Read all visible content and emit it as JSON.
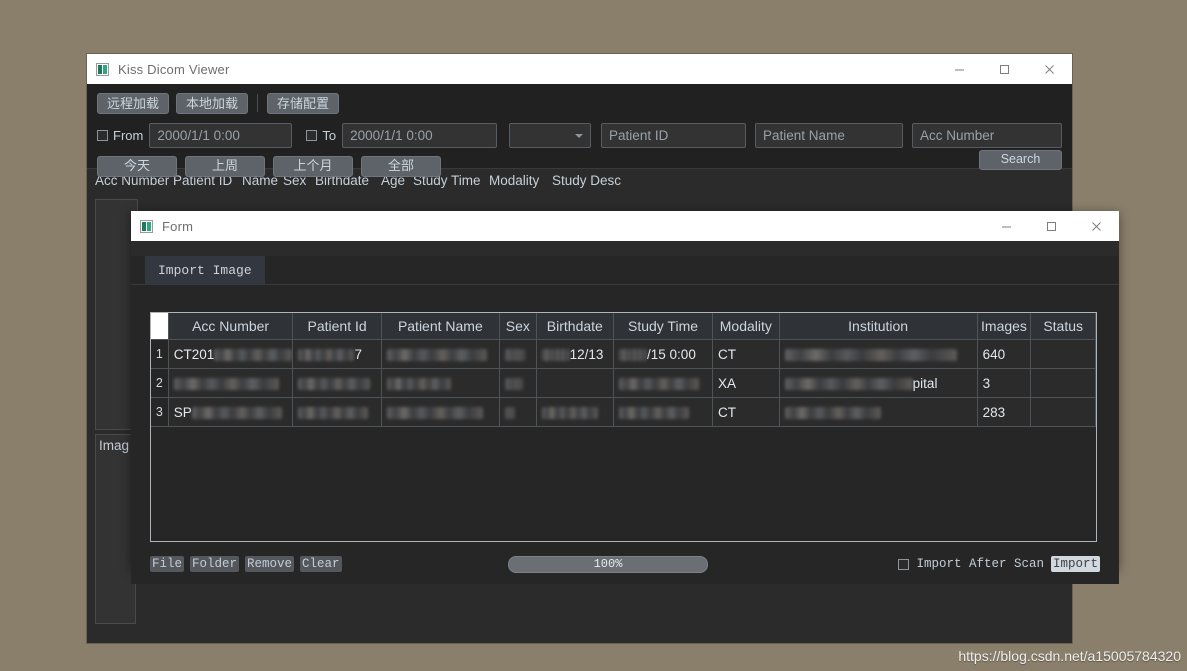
{
  "main_window": {
    "title": "Kiss Dicom Viewer",
    "icon": "app-icon",
    "window_controls": {
      "minimize": "—",
      "maximize": "□",
      "close": "✕"
    },
    "toolbar": {
      "buttons": [
        "远程加载",
        "本地加载",
        "存储配置"
      ],
      "from_label": "From",
      "from_value": "2000/1/1 0:00",
      "to_label": "To",
      "to_value": "2000/1/1 0:00",
      "modality_select": "",
      "patient_id_placeholder": "Patient ID",
      "patient_name_placeholder": "Patient Name",
      "acc_number_placeholder": "Acc Number",
      "quick_buttons": [
        "今天",
        "上周",
        "上个月",
        "全部"
      ],
      "search_label": "Search"
    },
    "grid_headers": [
      "Acc Number",
      "Patient ID",
      "Name",
      "Sex",
      "Birthdate",
      "Age",
      "Study Time",
      "Modality",
      "Study Desc"
    ],
    "image_panel_label": "Imag"
  },
  "form_window": {
    "title": "Form",
    "icon": "app-icon",
    "window_controls": {
      "minimize": "—",
      "maximize": "□",
      "close": "✕"
    },
    "tabs": [
      {
        "label": "Import Image",
        "active": true
      }
    ],
    "table": {
      "headers": [
        "",
        "Acc Number",
        "Patient Id",
        "Patient Name",
        "Sex",
        "Birthdate",
        "Study Time",
        "Modality",
        "Institution",
        "Images",
        "Status"
      ],
      "rows": [
        {
          "index": "1",
          "acc_number": "CT201",
          "acc_number_redacted": true,
          "patient_id": "7",
          "patient_id_redacted": true,
          "patient_name": "",
          "patient_name_redacted": true,
          "sex": "",
          "sex_redacted": true,
          "birthdate": "12/13",
          "birthdate_redacted": true,
          "study_time": "/15 0:00",
          "study_time_redacted": true,
          "modality": "CT",
          "institution": "",
          "institution_redacted": true,
          "images": "640",
          "status": ""
        },
        {
          "index": "2",
          "acc_number": "",
          "acc_number_redacted": true,
          "patient_id": "",
          "patient_id_redacted": true,
          "patient_name": "",
          "patient_name_redacted": true,
          "sex": "",
          "sex_redacted": true,
          "birthdate": "",
          "birthdate_redacted": false,
          "study_time": "",
          "study_time_redacted": true,
          "modality": "XA",
          "institution": "pital",
          "institution_redacted": true,
          "images": "3",
          "status": ""
        },
        {
          "index": "3",
          "acc_number": "SP",
          "acc_number_redacted": true,
          "patient_id": "",
          "patient_id_redacted": true,
          "patient_name": "",
          "patient_name_redacted": true,
          "sex": "",
          "sex_redacted": true,
          "birthdate": "",
          "birthdate_redacted": true,
          "study_time": "",
          "study_time_redacted": true,
          "modality": "CT",
          "institution": "",
          "institution_redacted": true,
          "images": "283",
          "status": ""
        }
      ]
    },
    "bottom": {
      "file_buttons": [
        "File",
        "Folder",
        "Remove",
        "Clear"
      ],
      "progress_value": "100%",
      "import_after_scan_label": "Import After Scan",
      "import_after_scan_checked": false,
      "import_button_label": "Import"
    }
  },
  "watermark": "https://blog.csdn.net/a15005784320",
  "colors": {
    "desktop": "#8a7f6b",
    "window_bg": "#2b2b2b",
    "toolbar_bg": "#212121",
    "titlebar_bg": "#ffffff",
    "accent_text": "#cbd3db",
    "button_bg": "#5d6368"
  }
}
